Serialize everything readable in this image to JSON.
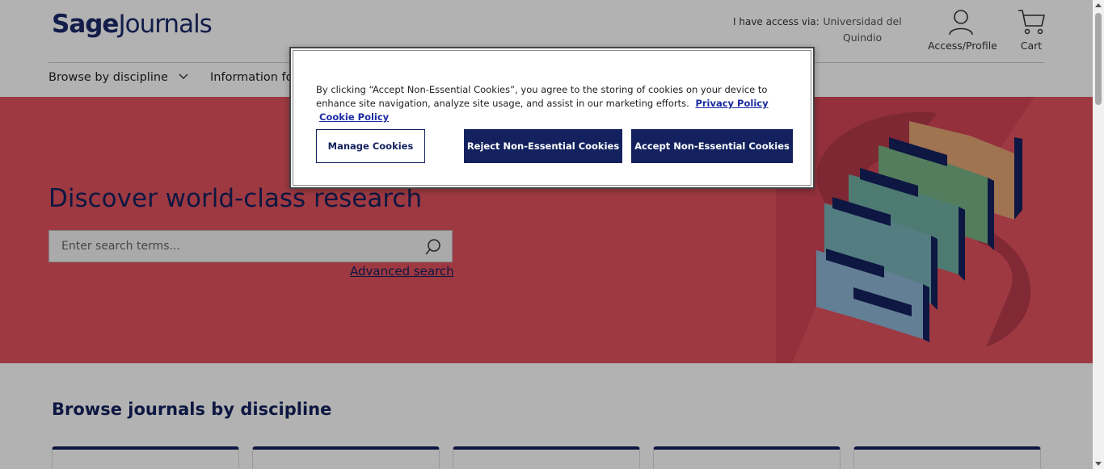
{
  "header": {
    "logo_primary": "Sage",
    "logo_secondary": "Journals",
    "access_label": "I have access via:",
    "institution": "Universidad del Quindio",
    "profile_label": "Access/Profile",
    "cart_label": "Cart"
  },
  "nav": {
    "items": [
      {
        "label": "Browse by discipline"
      },
      {
        "label": "Information fo"
      }
    ]
  },
  "hero": {
    "title": "Discover world-class research",
    "search_placeholder": "Enter search terms...",
    "advanced_search": "Advanced search"
  },
  "browse": {
    "title": "Browse journals by discipline"
  },
  "cookie_modal": {
    "text": "By clicking “Accept Non-Essential Cookies”, you agree to the storing of cookies on your device to enhance site navigation, analyze site usage, and assist in our marketing efforts.",
    "privacy_link": "Privacy Policy",
    "cookie_link": "Cookie Policy",
    "manage_label": "Manage Cookies",
    "reject_label": "Reject Non-Essential Cookies",
    "accept_label": "Accept Non-Essential Cookies"
  },
  "colors": {
    "brand_navy": "#13225e",
    "hero_red": "#e2525f"
  }
}
